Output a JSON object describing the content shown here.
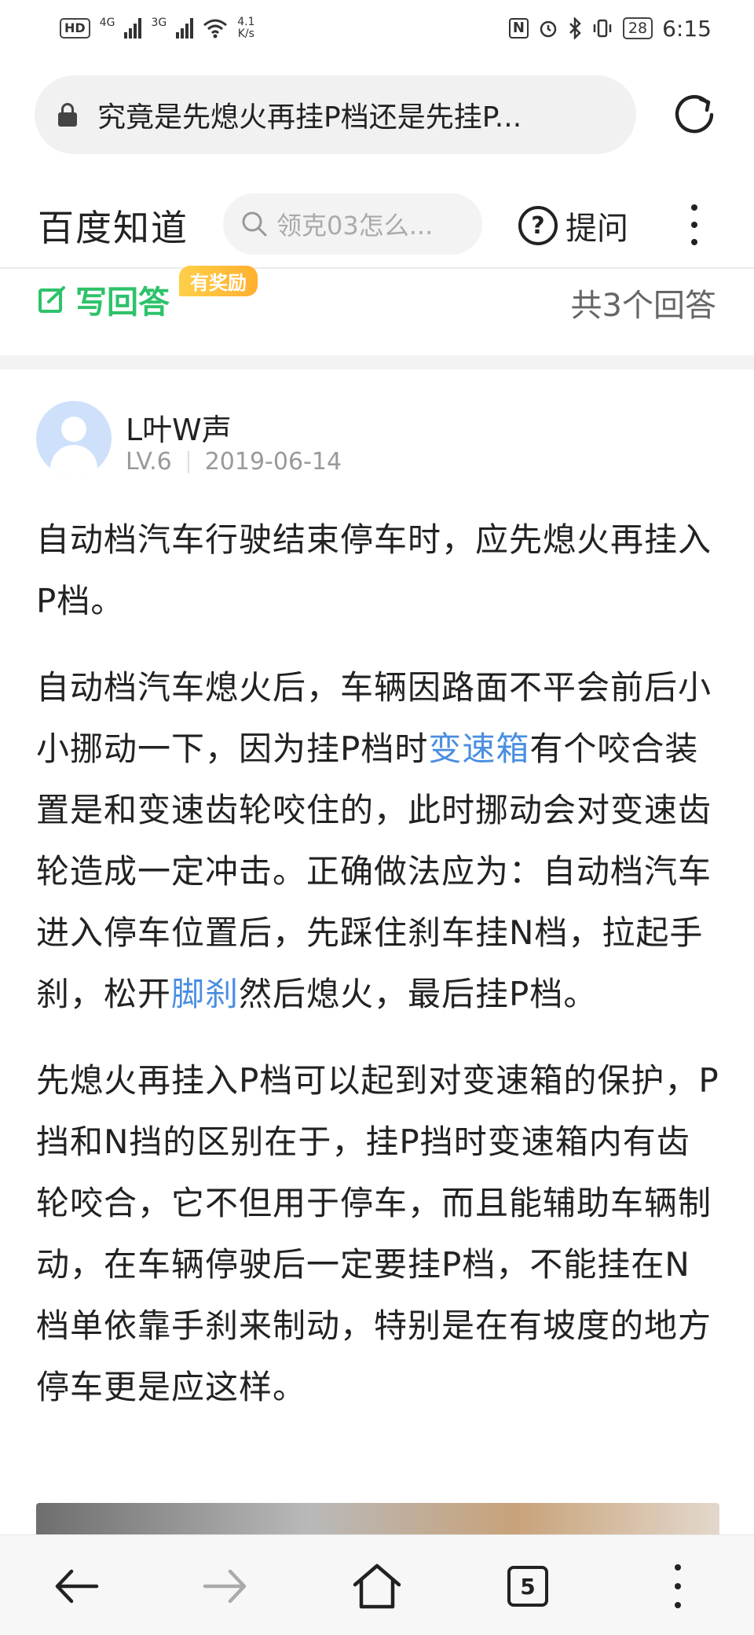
{
  "status_bar": {
    "hd_label": "HD",
    "net1": "4G",
    "net2": "3G",
    "speed_value": "4.1",
    "speed_unit": "K/s",
    "battery": "28",
    "time": "6:15"
  },
  "browser": {
    "url_title": "究竟是先熄火再挂P档还是先挂P..."
  },
  "site_header": {
    "logo": "百度知道",
    "search_placeholder": "领克03怎么...",
    "ask_label": "提问"
  },
  "answer_bar": {
    "write_label": "写回答",
    "reward_badge": "有奖励",
    "count": "共3个回答"
  },
  "answer": {
    "username": "L叶W声",
    "level": "LV.6",
    "date": "2019-06-14",
    "p1": "自动档汽车行驶结束停车时，应先熄火再挂入P档。",
    "p2_a": "自动档汽车熄火后，车辆因路面不平会前后小小挪动一下，因为挂P档时",
    "p2_link1": "变速箱",
    "p2_b": "有个咬合装置是和变速齿轮咬住的，此时挪动会对变速齿轮造成一定冲击。正确做法应为：自动档汽车进入停车位置后，先踩住刹车挂N档，拉起手刹，松开",
    "p2_link2": "脚刹",
    "p2_c": "然后熄火，最后挂P档。",
    "p3": "先熄火再挂入P档可以起到对变速箱的保护，P挡和N挡的区别在于，挂P挡时变速箱内有齿轮咬合，它不但用于停车，而且能辅助车辆制动，在车辆停驶后一定要挂P档，不能挂在N档单依靠手刹来制动，特别是在有坡度的地方停车更是应这样。"
  },
  "bottom_nav": {
    "tab_count": "5"
  },
  "colors": {
    "accent_green": "#2ec26b",
    "link_blue": "#4a8ee0",
    "reward_orange": "#ffb02e"
  }
}
